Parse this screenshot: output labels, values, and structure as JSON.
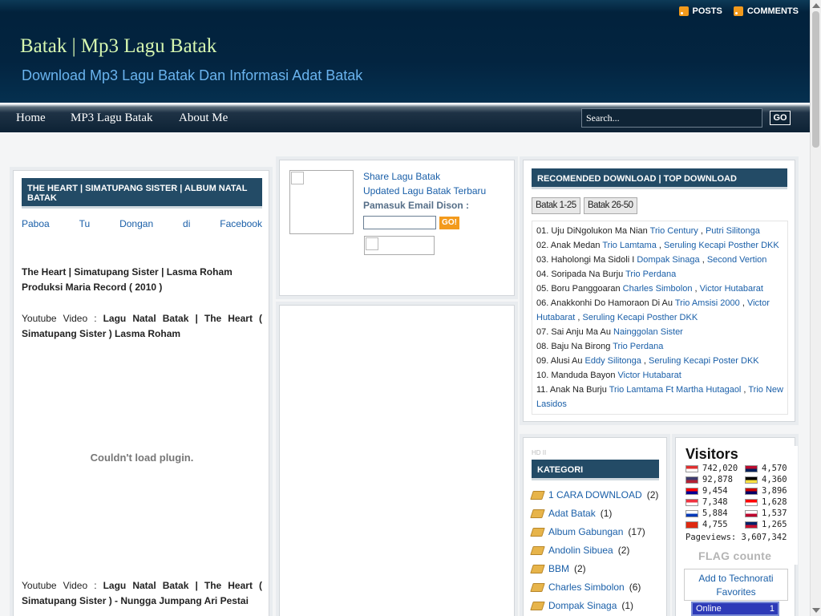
{
  "header": {
    "posts": "POSTS",
    "comments": "COMMENTS",
    "title": "Batak | Mp3 Lagu Batak",
    "description": "Download Mp3 Lagu Batak Dan Informasi Adat Batak"
  },
  "nav": {
    "items": [
      "Home",
      "MP3 Lagu Batak",
      "About Me"
    ],
    "search_value": "Search...",
    "go_label": "GO"
  },
  "post": {
    "title": "THE HEART | SIMATUPANG SISTER | ALBUM NATAL BATAK",
    "share_words": [
      "Paboa",
      "Tu",
      "Dongan",
      "di",
      "Facebook"
    ],
    "para1": "The Heart | Simatupang Sister | Lasma Roham Produksi Maria Record ( 2010 )",
    "para2_prefix": "Youtube Video : ",
    "para2_bold": "Lagu Natal Batak | The Heart ( Simatupang Sister ) Lasma Roham",
    "plugin": "Couldn't load plugin.",
    "para3_prefix": "Youtube Video : ",
    "para3_bold": "Lagu Natal Batak | The Heart ( Simatupang Sister ) - Nungga Jumpang Ari Pestai"
  },
  "subscribe": {
    "link1": "Share Lagu Batak",
    "link2": "Updated Lagu Batak Terbaru",
    "label": "Pamasuk Email Dison :",
    "go_label": "GO!"
  },
  "recommended": {
    "title": "RECOMENDED DOWNLOAD | TOP DOWNLOAD",
    "tabs": [
      "Batak 1-25",
      "Batak 26-50"
    ],
    "items": [
      {
        "n": "01.",
        "song": "Uju DiNgolukon Ma Nian",
        "artists": [
          "Trio Century",
          "Putri Silitonga"
        ]
      },
      {
        "n": "02.",
        "song": "Anak Medan",
        "artists": [
          "Trio Lamtama",
          "Seruling Kecapi Posther DKK"
        ]
      },
      {
        "n": "03.",
        "song": "Haholongi Ma Sidoli I",
        "artists": [
          "Dompak Sinaga",
          "Second Vertion"
        ]
      },
      {
        "n": "04.",
        "song": "Soripada Na Burju",
        "artists": [
          "Trio Perdana"
        ]
      },
      {
        "n": "05.",
        "song": "Boru Panggoaran",
        "artists": [
          "Charles Simbolon",
          "Victor Hutabarat"
        ]
      },
      {
        "n": "06.",
        "song": "Anakkonhi Do Hamoraon Di Au",
        "artists": [
          "Trio Amsisi 2000",
          "Victor Hutabarat",
          "Seruling Kecapi Posther DKK"
        ]
      },
      {
        "n": "07.",
        "song": "Sai Anju Ma Au",
        "artists": [
          "Nainggolan Sister"
        ]
      },
      {
        "n": "08.",
        "song": "Baju Na Birong",
        "artists": [
          "Trio Perdana"
        ]
      },
      {
        "n": "09.",
        "song": "Alusi Au",
        "artists": [
          "Eddy Silitonga",
          "Seruling Kecapi Poster DKK"
        ]
      },
      {
        "n": "10.",
        "song": "Manduda Bayon",
        "artists": [
          "Victor Hutabarat"
        ]
      },
      {
        "n": "11.",
        "song": "Anak Na Burju",
        "artists": [
          "Trio Lamtama Ft Martha Hutagaol",
          "Trio New Lasidos"
        ]
      }
    ]
  },
  "kategori": {
    "tiny": "HD II",
    "title": "KATEGORI",
    "items": [
      {
        "name": "1 CARA DOWNLOAD",
        "count": "(2)"
      },
      {
        "name": "Adat Batak",
        "count": "(1)"
      },
      {
        "name": "Album Gabungan",
        "count": "(17)"
      },
      {
        "name": "Andolin Sibuea",
        "count": "(2)"
      },
      {
        "name": "BBM",
        "count": "(2)"
      },
      {
        "name": "Charles Simbolon",
        "count": "(6)"
      },
      {
        "name": "Dompak Sinaga",
        "count": "(1)"
      }
    ]
  },
  "visitors": {
    "title": "Visitors",
    "left": [
      {
        "count": "742,020",
        "colors": [
          "#e03030",
          "#ffffff"
        ]
      },
      {
        "count": "92,878",
        "colors": [
          "#3c3b6e",
          "#b22234"
        ]
      },
      {
        "count": "9,454",
        "colors": [
          "#fe0000",
          "#000095"
        ]
      },
      {
        "count": "7,348",
        "colors": [
          "#ef3340",
          "#ffffff"
        ]
      },
      {
        "count": "5,884",
        "colors": [
          "#ffffff",
          "#0038b8"
        ]
      },
      {
        "count": "4,755",
        "colors": [
          "#de2910",
          "#de2910"
        ]
      }
    ],
    "right": [
      {
        "count": "4,570",
        "colors": [
          "#ba0c2f",
          "#00205b"
        ]
      },
      {
        "count": "4,360",
        "colors": [
          "#000000",
          "#fae042"
        ]
      },
      {
        "count": "3,896",
        "colors": [
          "#cc0001",
          "#010066"
        ]
      },
      {
        "count": "1,628",
        "colors": [
          "#ff0000",
          "#ffffff"
        ]
      },
      {
        "count": "1,537",
        "colors": [
          "#ffffff",
          "#bc002d"
        ]
      },
      {
        "count": "1,265",
        "colors": [
          "#012169",
          "#c8102e"
        ]
      }
    ],
    "pageviews_label": "Pageviews:",
    "pageviews": "3,607,342",
    "flag_counter": "FLAG counte",
    "technorati": "Add to Technorati Favorites",
    "online_label": "Online",
    "online_count": "1"
  }
}
